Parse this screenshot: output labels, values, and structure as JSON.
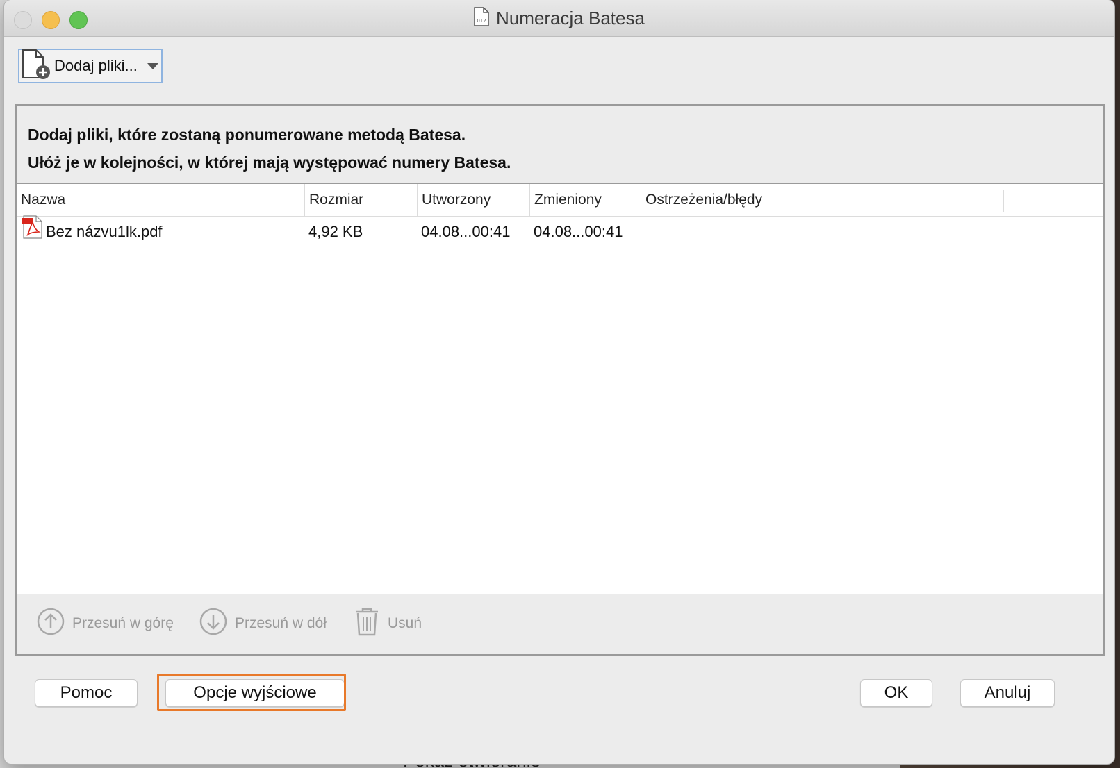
{
  "window": {
    "title": "Numeracja Batesa"
  },
  "toolbar": {
    "add_files_label": "Dodaj pliki..."
  },
  "instructions": {
    "line1": "Dodaj pliki, które zostaną ponumerowane metodą Batesa.",
    "line2": "Ułóż je w kolejności, w której mają występować numery Batesa."
  },
  "table": {
    "columns": [
      "Nazwa",
      "Rozmiar",
      "Utworzony",
      "Zmieniony",
      "Ostrzeżenia/błędy"
    ],
    "rows": [
      {
        "name": "Bez názvu1lk.pdf",
        "size": "4,92 KB",
        "created": "04.08...00:41",
        "modified": "04.08...00:41",
        "warnings": ""
      }
    ]
  },
  "list_actions": {
    "move_up": "Przesuń w górę",
    "move_down": "Przesuń w dół",
    "delete": "Usuń"
  },
  "footer": {
    "help": "Pomoc",
    "output_options": "Opcje wyjściowe",
    "ok": "OK",
    "cancel": "Anuluj"
  },
  "background": {
    "peek_text": "Pokaż otwieranie"
  },
  "colors": {
    "focus_ring": "#e8792a",
    "toolbar_focus": "#8fb4e0",
    "pdf_red": "#d9261c"
  }
}
